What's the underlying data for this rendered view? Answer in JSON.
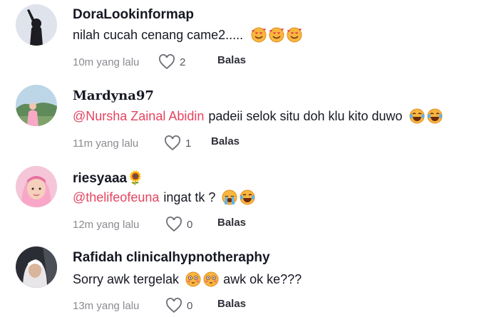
{
  "comments": [
    {
      "username": "DoraLookinformap",
      "text": "nilah cucah cenang came2.....",
      "mention": "",
      "emojis": [
        "smiling-face-hearts-icon",
        "smiling-face-hearts-icon",
        "smiling-face-hearts-icon"
      ],
      "time": "10m yang lalu",
      "likes": "2",
      "reply": "Balas"
    },
    {
      "username": "𝐌𝐚𝐫𝐝𝐲𝐧𝐚𝟗𝟕",
      "text": "padeii selok situ doh klu kito duwo",
      "mention": "@Nursha Zainal Abidin",
      "emojis": [
        "tears-of-joy-icon",
        "tears-of-joy-icon"
      ],
      "time": "11m yang lalu",
      "likes": "1",
      "reply": "Balas"
    },
    {
      "username": "riesyaaa🌻",
      "text": "ingat tk ?",
      "mention": "@thelifeofeuna",
      "emojis": [
        "loudly-crying-icon",
        "tears-of-joy-icon"
      ],
      "time": "12m yang lalu",
      "likes": "0",
      "reply": "Balas"
    },
    {
      "username": "Rafidah clinicalhypnotheraphy",
      "text": "Sorry awk tergelak",
      "text_after": "awk ok ke???",
      "mention": "",
      "emojis": [
        "flushed-face-icon",
        "flushed-face-icon"
      ],
      "time": "13m yang lalu",
      "likes": "0",
      "reply": "Balas"
    }
  ],
  "colors": {
    "mention": "#e5445f",
    "meta": "#8a8b91",
    "text": "#161823"
  }
}
